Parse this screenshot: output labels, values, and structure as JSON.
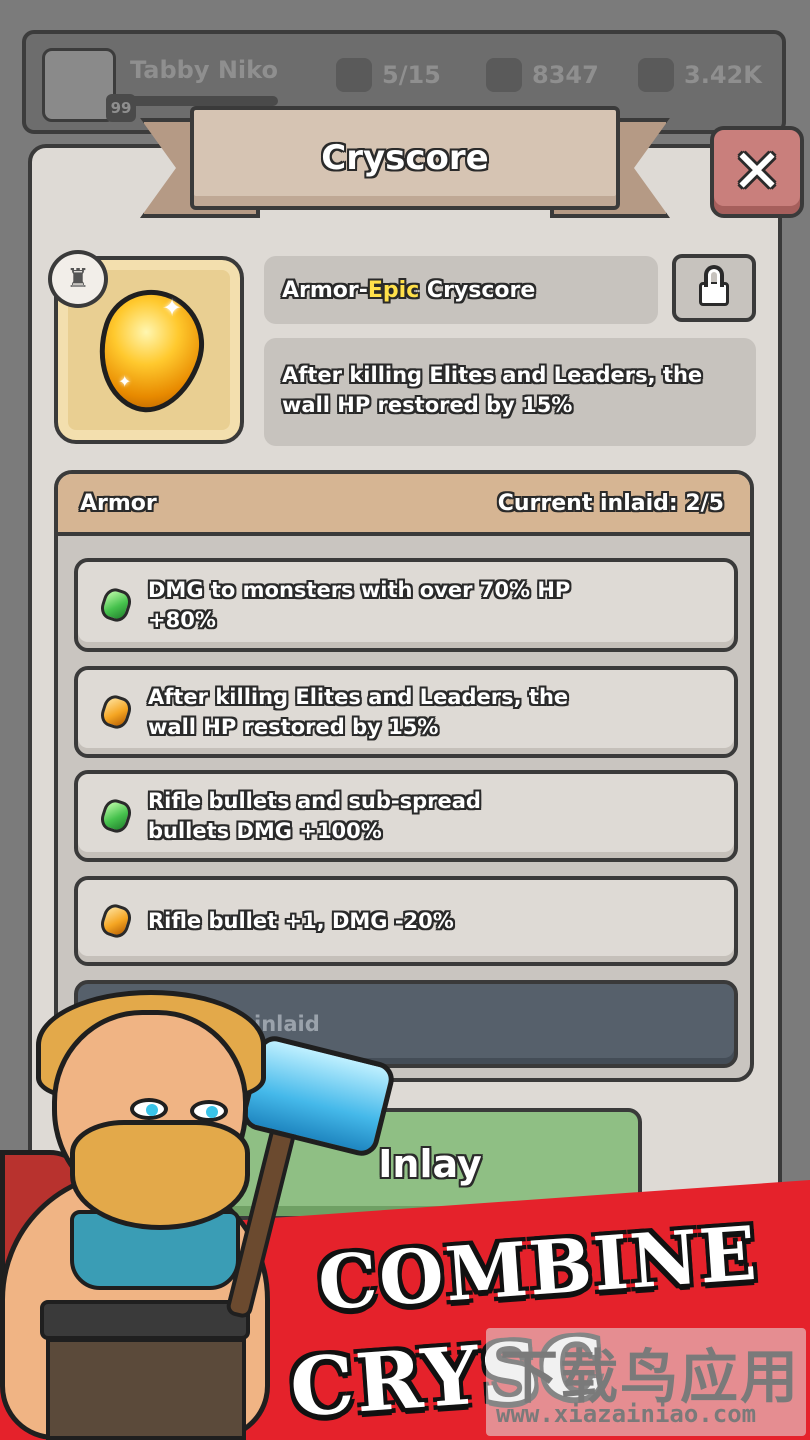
{
  "hud": {
    "player_name": "Tabby Niko",
    "player_level": "99",
    "resources": [
      {
        "icon": "crystal-ore-icon",
        "value": "5/15"
      },
      {
        "icon": "rock-plus-icon",
        "value": "8347"
      },
      {
        "icon": "meat-plus-icon",
        "value": "3.42K"
      }
    ]
  },
  "dialog": {
    "title": "Cryscore",
    "close_icon": "close-icon",
    "item": {
      "type_prefix": "Armor-",
      "rarity": "Epic",
      "name_suffix": " Cryscore",
      "description": "After killing Elites and Leaders, the wall HP restored by 15%",
      "type_badge_icon": "armor-icon",
      "lock_icon": "lock-icon"
    },
    "slots": {
      "category": "Armor",
      "inlaid_label": "Current inlaid: 2/5",
      "items": [
        {
          "gem": "green",
          "text": "DMG to monsters with over 70% HP +80%"
        },
        {
          "gem": "orange",
          "text": "After killing Elites and Leaders, the wall HP restored by 15%"
        },
        {
          "gem": "green",
          "text": "Rifle bullets and sub-spread bullets DMG +100%"
        },
        {
          "gem": "orange",
          "text": "Rifle bullet +1, DMG -20%"
        }
      ],
      "empty_text": "inlaid"
    },
    "inlay_button": "Inlay"
  },
  "promo": {
    "line1": "COMBINE",
    "line2": "CRYSC"
  },
  "watermark": {
    "cn": "下载鸟应用",
    "url": "www.xiazainiao.com"
  },
  "colors": {
    "rarity_epic": "#ffe04a",
    "promo_red": "#e5222b",
    "inlay_green": "#8fbf84",
    "close_red": "#c97f7c"
  }
}
